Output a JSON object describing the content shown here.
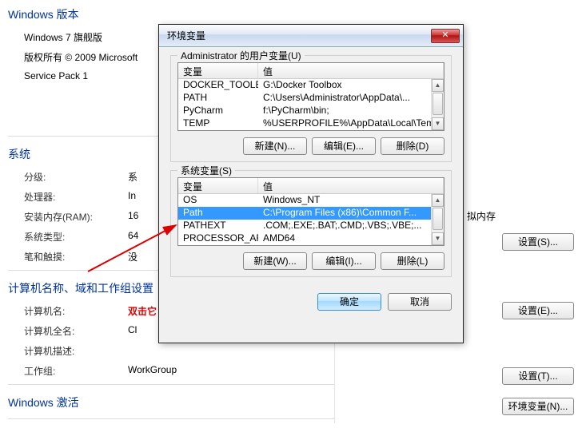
{
  "bg": {
    "windows_section": "Windows 版本",
    "edition": "Windows 7 旗舰版",
    "copyright": "版权所有 © 2009 Microsoft",
    "sp": "Service Pack 1",
    "system_section": "系统",
    "rating_lbl": "分级:",
    "rating_val": "系",
    "cpu_lbl": "处理器:",
    "cpu_val": "In",
    "ram_lbl": "安装内存(RAM):",
    "ram_val": "16",
    "type_lbl": "系统类型:",
    "type_val": "64",
    "pen_lbl": "笔和触摸:",
    "pen_val": "没",
    "computer_section": "计算机名称、域和工作组设置",
    "cname_lbl": "计算机名:",
    "cname_note": "双击它",
    "cname_val": "Cl",
    "cfull_lbl": "计算机全名:",
    "cfull_val": "Cl",
    "cdesc_lbl": "计算机描述:",
    "wg_lbl": "工作组:",
    "wg_val": "WorkGroup",
    "activation_section": "Windows 激活",
    "vmem": "拟内存"
  },
  "right_buttons": {
    "settings_s": "设置(S)...",
    "settings_e": "设置(E)...",
    "settings_t": "设置(T)...",
    "env": "环境变量(N)..."
  },
  "dialog": {
    "title": "环境变量",
    "user_group_title": "Administrator 的用户变量(U)",
    "sys_group_title": "系统变量(S)",
    "col_var": "变量",
    "col_val": "值",
    "user_vars": [
      {
        "name": "DOCKER_TOOLB...",
        "value": "G:\\Docker Toolbox"
      },
      {
        "name": "PATH",
        "value": "C:\\Users\\Administrator\\AppData\\..."
      },
      {
        "name": "PyCharm",
        "value": "f:\\PyCharm\\bin;"
      },
      {
        "name": "TEMP",
        "value": "%USERPROFILE%\\AppData\\Local\\Temp"
      }
    ],
    "sys_vars": [
      {
        "name": "OS",
        "value": "Windows_NT"
      },
      {
        "name": "Path",
        "value": "C:\\Program Files (x86)\\Common F..."
      },
      {
        "name": "PATHEXT",
        "value": ".COM;.EXE;.BAT;.CMD;.VBS;.VBE;..."
      },
      {
        "name": "PROCESSOR_AR...",
        "value": "AMD64"
      }
    ],
    "sys_selected_index": 1,
    "btn_new_n": "新建(N)...",
    "btn_edit_e": "编辑(E)...",
    "btn_del_d": "删除(D)",
    "btn_new_w": "新建(W)...",
    "btn_edit_i": "编辑(I)...",
    "btn_del_l": "删除(L)",
    "btn_ok": "确定",
    "btn_cancel": "取消"
  }
}
